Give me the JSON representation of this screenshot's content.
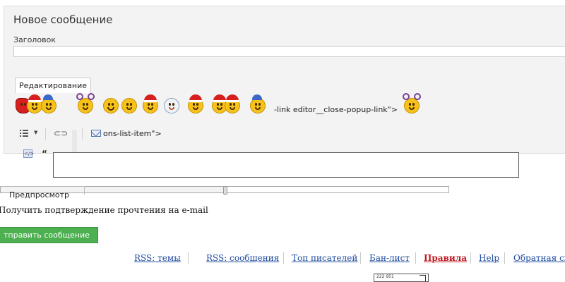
{
  "form": {
    "title": "Новое сообщение",
    "title_label": "Заголовок",
    "title_value": "",
    "tab_label": "Редактирование",
    "leaky_text": "-link editor__close-popup-link\">",
    "toolbar_env_text": "ons-list-item\">",
    "toolbar_quote": "“",
    "toolbar_src": "</>",
    "preview_label": "Предпросмотр",
    "confirm_label": "Получить подтверждение прочтения на e-mail",
    "send_button": "тправить сообщение",
    "captcha_text": "222 951"
  },
  "smileys": [
    {
      "icon": "santa-sack-icon"
    },
    {
      "icon": "santa-smiley-icon"
    },
    {
      "icon": "blue-hat-smiley-icon"
    },
    {
      "icon": "horned-smiley-icon"
    },
    {
      "icon": "grin-smiley-icon"
    },
    {
      "icon": "goggle-smiley-icon"
    },
    {
      "icon": "santa-smiley-icon"
    },
    {
      "icon": "snowman-icon"
    },
    {
      "icon": "santa-staff-icon"
    },
    {
      "icon": "twin-santa-icon"
    },
    {
      "icon": "blue-hat-smiley-icon"
    },
    {
      "icon": "horned-smiley-icon"
    }
  ],
  "footer": {
    "links": [
      {
        "label": "RSS: темы"
      },
      {
        "label": "RSS: сообщения"
      },
      {
        "label": "Топ писателей"
      },
      {
        "label": "Бан-лист"
      },
      {
        "label": "Правила"
      },
      {
        "label": "Help"
      },
      {
        "label": "Обратная св"
      }
    ]
  },
  "progress": {
    "value": 0.5
  }
}
